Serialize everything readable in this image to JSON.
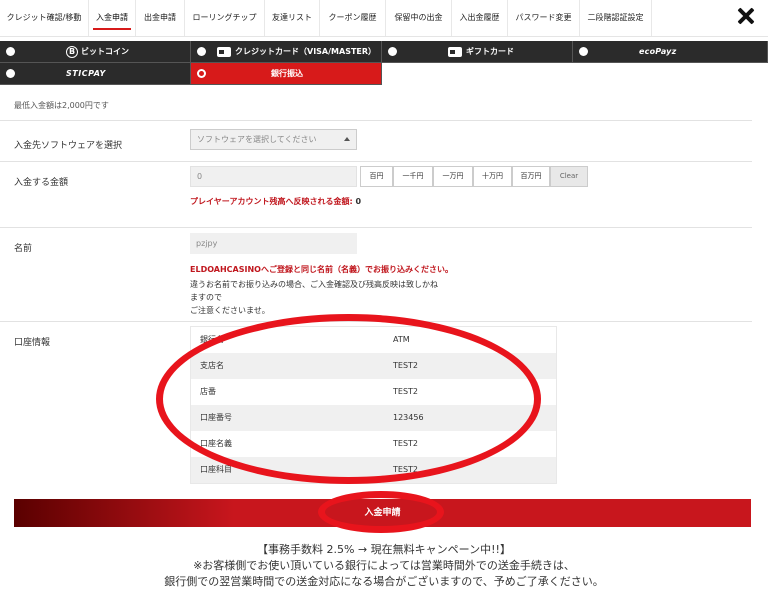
{
  "nav": {
    "tabs": [
      {
        "label": "クレジット確認/移動"
      },
      {
        "label": "入金申請"
      },
      {
        "label": "出金申請"
      },
      {
        "label": "ローリングチップ"
      },
      {
        "label": "友達リスト"
      },
      {
        "label": "クーポン履歴"
      },
      {
        "label": "保留中の出金"
      },
      {
        "label": "入出金履歴"
      },
      {
        "label": "パスワード変更"
      },
      {
        "label": "二段階認証設定"
      }
    ],
    "active_tab": "入金申請",
    "close_icon": "close-icon"
  },
  "methods": {
    "bitcoin": "ビットコイン",
    "credit_card": "クレジットカード（VISA/MASTER）",
    "gift_card": "ギフトカード",
    "ecopayz": "ecoPayz",
    "sticpay": "STICPAY",
    "bank": "銀行振込",
    "selected": "銀行振込",
    "accent_color": "#d71a1a"
  },
  "form": {
    "min_notice": "最低入金額は2,000円です",
    "software_label": "入金先ソフトウェアを選択",
    "software_placeholder": "ソフトウェアを選択してください",
    "amount_label": "入金する金額",
    "amount_value": "0",
    "amount_buttons": [
      "百円",
      "一千円",
      "一万円",
      "十万円",
      "百万円",
      "Clear"
    ],
    "reflect_note_prefix": "プレイヤーアカウント残高へ反映される金額:",
    "reflect_amount": "0",
    "name_label": "名前",
    "name_value": "pzjpy",
    "name_note_red": "ELDOAHCASINOへご登録と同じ名前（名義）でお振り込みください。",
    "name_note_1": "違うお名前でお振り込みの場合、ご入金確認及び残高反映は致しかね",
    "name_note_2": "ますので",
    "name_note_3": "ご注意くださいませ。",
    "bank_label": "口座情報"
  },
  "bank_info": [
    {
      "key": "銀行名",
      "value": "ATM"
    },
    {
      "key": "支店名",
      "value": "TEST2"
    },
    {
      "key": "店番",
      "value": "TEST2"
    },
    {
      "key": "口座番号",
      "value": "123456"
    },
    {
      "key": "口座名義",
      "value": "TEST2"
    },
    {
      "key": "口座科目",
      "value": "TEST2"
    }
  ],
  "submit_label": "入金申請",
  "footer": {
    "line1": "【事務手数料 2.5% → 現在無料キャンペーン中!!】",
    "line2": "※お客様側でお使い頂いている銀行によっては営業時間外での送金手続きは、",
    "line3": "銀行側での翌営業時間での送金対応になる場合がございますので、予めご了承ください。"
  }
}
